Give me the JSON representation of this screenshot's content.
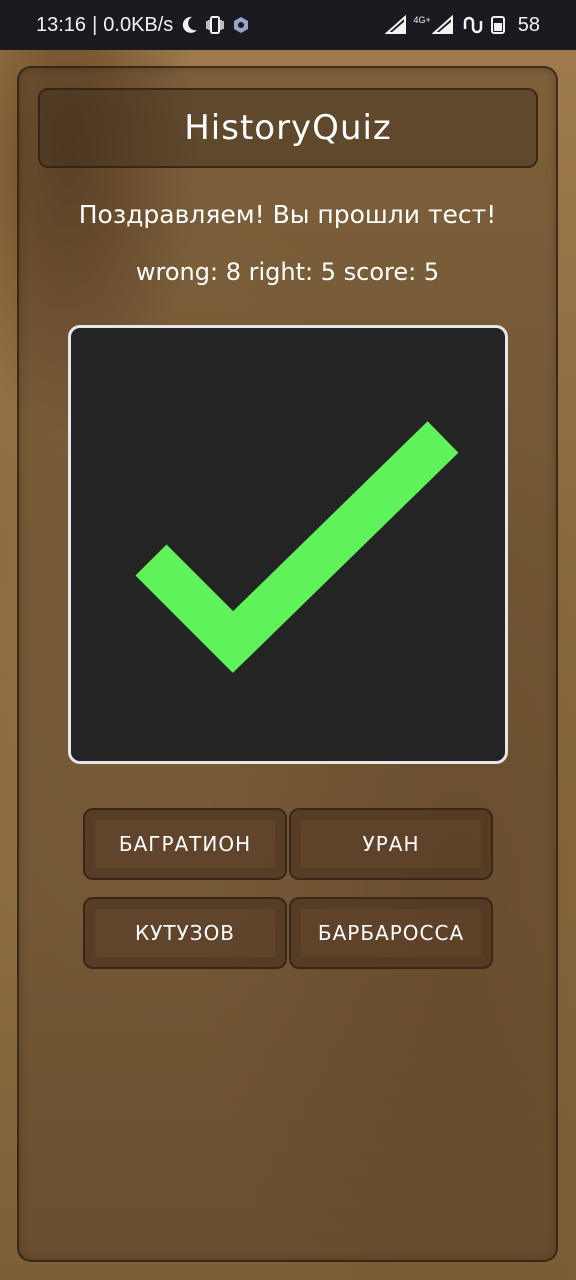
{
  "status_bar": {
    "time": "13:16",
    "separator": "|",
    "net_speed": "0.0KB/s",
    "network_label": "4G+",
    "battery": "58",
    "icons": [
      "moon-icon",
      "vibrate-icon",
      "settings-hex-icon",
      "signal-icon",
      "signal-4g-icon",
      "link-icon",
      "battery-icon"
    ]
  },
  "app": {
    "title": "HistoryQuiz"
  },
  "result": {
    "message": "Поздравляем! Вы прошли тест!",
    "score_line": "wrong: 8 right: 5 score: 5"
  },
  "image": {
    "icon": "checkmark-icon",
    "background_color": "#242424",
    "check_color": "#5ff25a"
  },
  "answers": [
    {
      "label": "БАГРАТИОН"
    },
    {
      "label": "УРАН"
    },
    {
      "label": "КУТУЗОВ"
    },
    {
      "label": "БАРБАРОССА"
    }
  ]
}
